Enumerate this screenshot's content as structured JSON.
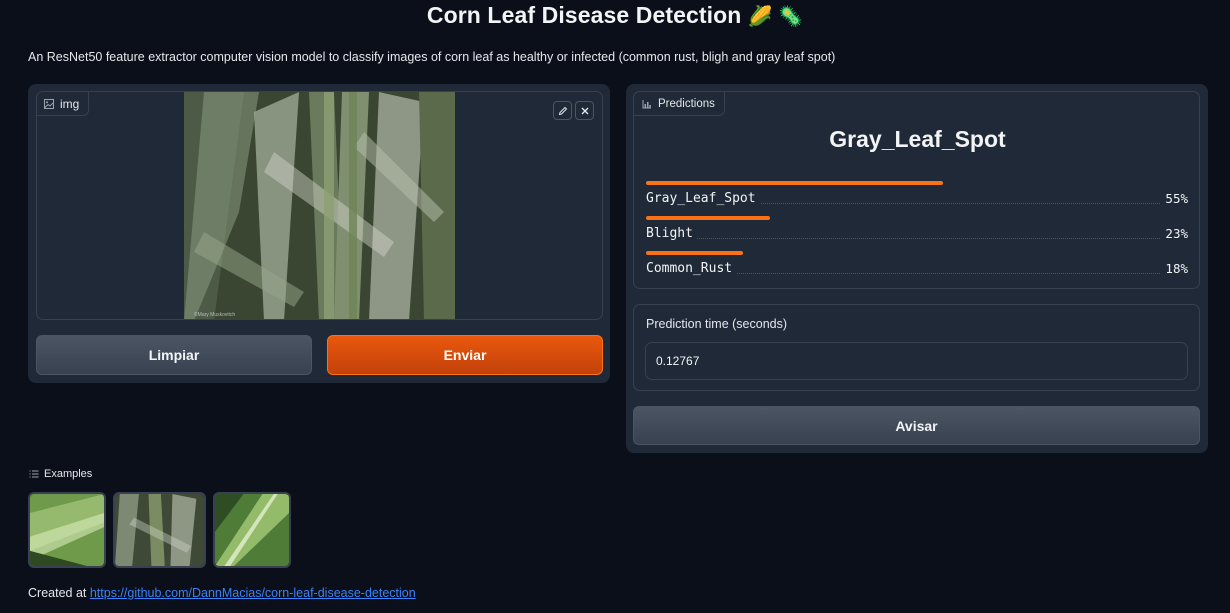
{
  "header": {
    "title": "Corn Leaf Disease Detection",
    "title_emoji": "🌽 🦠",
    "description": "An ResNet50 feature extractor computer vision model to classify images of corn leaf as healthy or infected (common rust, bligh and gray leaf spot)"
  },
  "input": {
    "label": "img",
    "photo_credit": "©Mary Muskovitch",
    "clear_button": "Limpiar",
    "submit_button": "Enviar"
  },
  "predictions": {
    "label": "Predictions",
    "top_label": "Gray_Leaf_Spot",
    "items": [
      {
        "name": "Gray_Leaf_Spot",
        "confidence": 0.55,
        "display": "55%"
      },
      {
        "name": "Blight",
        "confidence": 0.23,
        "display": "23%"
      },
      {
        "name": "Common_Rust",
        "confidence": 0.18,
        "display": "18%"
      }
    ]
  },
  "timing": {
    "label": "Prediction time (seconds)",
    "value": "0.12767"
  },
  "flag_button": "Avisar",
  "examples": {
    "label": "Examples",
    "items": [
      {
        "name": "healthy-leaf-example"
      },
      {
        "name": "gray-leaf-spot-example"
      },
      {
        "name": "healthy-leaf-closeup-example"
      }
    ]
  },
  "footer": {
    "prefix": "Created at ",
    "link_text": "https://github.com/DannMacias/corn-leaf-disease-detection"
  },
  "colors": {
    "background": "#0b0f19",
    "panel": "#1f2937",
    "accent": "#f97316",
    "link": "#3b82f6"
  }
}
